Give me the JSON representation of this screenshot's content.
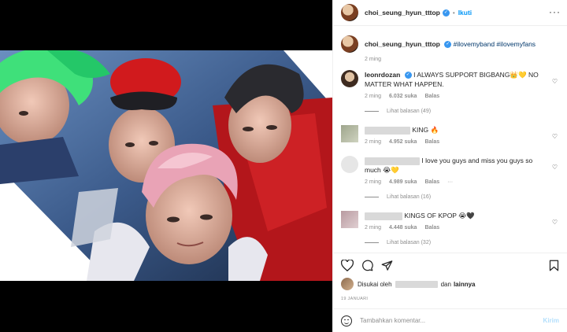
{
  "header": {
    "username": "choi_seung_hyun_tttop",
    "follow_label": "Ikuti",
    "more_label": "···"
  },
  "caption": {
    "username": "choi_seung_hyun_tttop",
    "text": "#ilovemyband #ilovemyfans",
    "time": "2 ming"
  },
  "comments": [
    {
      "username": "leonrdozan",
      "text": "I ALWAYS SUPPORT BIGBANG👑💛 NO MATTER WHAT HAPPEN.",
      "time": "2 ming",
      "likes": "6.032 suka",
      "reply_label": "Balas",
      "view_replies": "Lihat balasan (49)"
    },
    {
      "username": "",
      "text": "KING 🔥",
      "time": "2 ming",
      "likes": "4.952 suka",
      "reply_label": "Balas"
    },
    {
      "username": "",
      "text": "I love you guys and miss you guys so much 😭💛",
      "time": "2 ming",
      "likes": "4.989 suka",
      "reply_label": "Balas",
      "options": "···",
      "view_replies": "Lihat balasan (16)"
    },
    {
      "username": "",
      "text": "KINGS OF KPOP 😭🖤",
      "time": "2 ming",
      "likes": "4.448 suka",
      "reply_label": "Balas",
      "view_replies": "Lihat balasan (32)"
    }
  ],
  "likes_line": {
    "prefix": "Disukai oleh",
    "suffix": "dan",
    "others": "lainnya"
  },
  "date": "19 JANUARI",
  "add_comment": {
    "placeholder": "Tambahkan komentar...",
    "post_label": "Kirim"
  },
  "colors": {
    "accent": "#0095f6",
    "verified": "#3897f0",
    "muted": "#8e8e8e",
    "post_disabled": "#b2dffc"
  },
  "icons": [
    "heart-icon",
    "comment-icon",
    "share-icon",
    "bookmark-icon",
    "emoji-icon",
    "verified-icon",
    "more-icon"
  ]
}
